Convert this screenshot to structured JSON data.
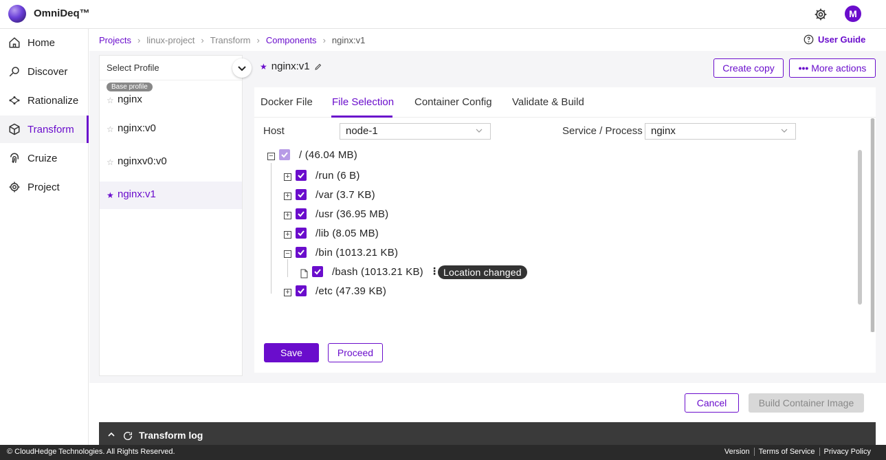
{
  "app": {
    "name": "OmniDeq™",
    "avatar_initial": "M"
  },
  "sidebar": {
    "items": [
      {
        "label": "Home",
        "icon": "home-icon"
      },
      {
        "label": "Discover",
        "icon": "discover-icon"
      },
      {
        "label": "Rationalize",
        "icon": "rationalize-icon"
      },
      {
        "label": "Transform",
        "icon": "cube-icon",
        "active": true
      },
      {
        "label": "Cruize",
        "icon": "fingerprint-icon"
      },
      {
        "label": "Project",
        "icon": "gear-icon"
      }
    ]
  },
  "breadcrumb": {
    "items": [
      "Projects",
      "linux-project",
      "Transform",
      "Components",
      "nginx:v1"
    ],
    "user_guide": "User Guide"
  },
  "profiles": {
    "select_label": "Select Profile",
    "base_badge": "Base profile",
    "items": [
      "nginx",
      "nginx:v0",
      "nginxv0:v0",
      "nginx:v1"
    ],
    "active": "nginx:v1"
  },
  "component": {
    "title": "nginx:v1",
    "create_copy": "Create copy",
    "more_actions": "More actions"
  },
  "tabs": [
    "Docker File",
    "File Selection",
    "Container Config",
    "Validate & Build"
  ],
  "active_tab": "File Selection",
  "filters": {
    "host_label": "Host",
    "host_value": "node-1",
    "service_label": "Service / Process",
    "service_value": "nginx"
  },
  "tree": {
    "root": "/ (46.04 MB)",
    "children": [
      {
        "label": "/run (6 B)",
        "expanded": false
      },
      {
        "label": "/var (3.7 KB)",
        "expanded": false
      },
      {
        "label": "/usr (36.95 MB)",
        "expanded": false
      },
      {
        "label": "/lib (8.05 MB)",
        "expanded": false
      },
      {
        "label": "/bin (1013.21 KB)",
        "expanded": true
      },
      {
        "label": "/bash (1013.21 KB)",
        "file": true,
        "tooltip": "Location changed"
      },
      {
        "label": "/etc (47.39 KB)",
        "expanded": false
      }
    ]
  },
  "actions": {
    "save": "Save",
    "proceed": "Proceed",
    "cancel": "Cancel",
    "build": "Build Container Image"
  },
  "transform_log": {
    "label": "Transform log"
  },
  "footer": {
    "copyright": "© CloudHedge Technologies. All Rights Reserved.",
    "links": [
      "Version",
      "Terms of Service",
      "Privacy Policy"
    ]
  },
  "colors": {
    "accent": "#6a0dcc",
    "disabled": "#d8d8d8"
  }
}
